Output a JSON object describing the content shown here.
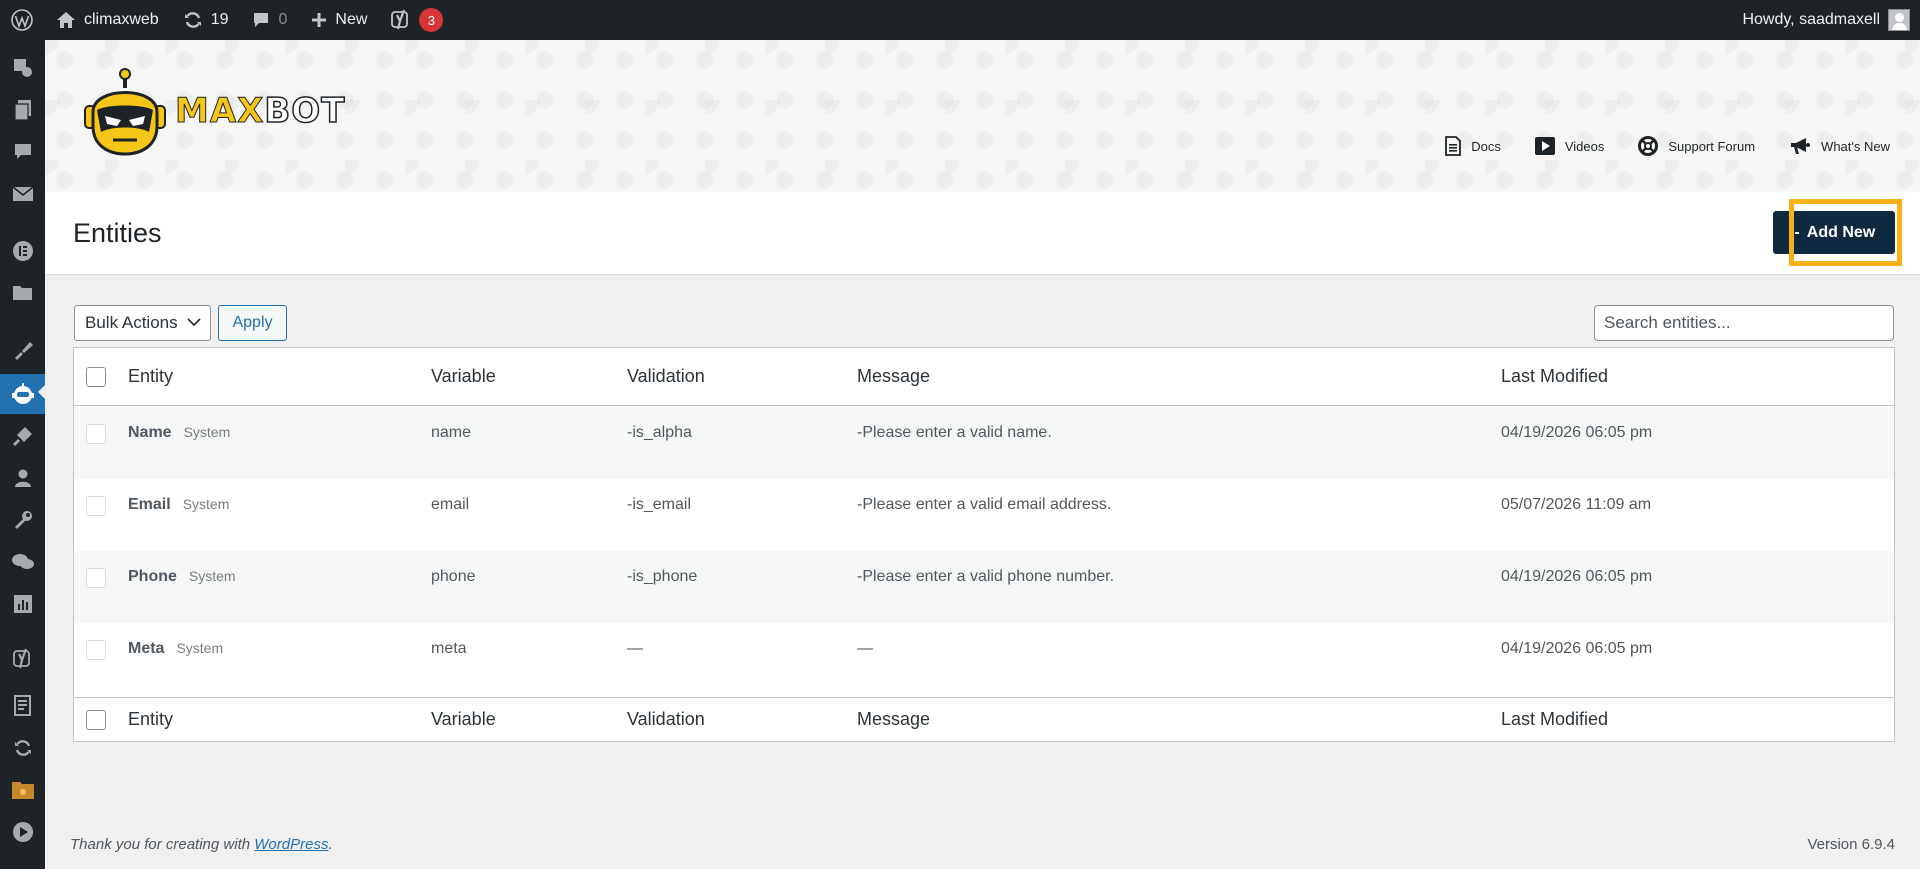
{
  "adminbar": {
    "site_name": "climaxweb",
    "updates_count": "19",
    "comments_count": "0",
    "new_label": "New",
    "seo_badge": "3",
    "greeting": "Howdy, saadmaxell"
  },
  "plugin": {
    "logo_max": "MAX",
    "logo_bot": "BOT",
    "links": {
      "docs": "Docs",
      "videos": "Videos",
      "support": "Support Forum",
      "whats_new": "What's New"
    }
  },
  "page": {
    "title": "Entities",
    "add_new_label": "Add New"
  },
  "controls": {
    "bulk_actions": "Bulk Actions",
    "apply": "Apply",
    "search_placeholder": "Search entities..."
  },
  "table": {
    "columns": {
      "entity": "Entity",
      "variable": "Variable",
      "validation": "Validation",
      "message": "Message",
      "last_modified": "Last Modified"
    },
    "rows": [
      {
        "name": "Name",
        "type": "System",
        "variable": "name",
        "validation": "-is_alpha",
        "message": "-Please enter a valid name.",
        "modified": "04/19/2026 06:05 pm"
      },
      {
        "name": "Email",
        "type": "System",
        "variable": "email",
        "validation": "-is_email",
        "message": "-Please enter a valid email address.",
        "modified": "05/07/2026 11:09 am"
      },
      {
        "name": "Phone",
        "type": "System",
        "variable": "phone",
        "validation": "-is_phone",
        "message": "-Please enter a valid phone number.",
        "modified": "04/19/2026 06:05 pm"
      },
      {
        "name": "Meta",
        "type": "System",
        "variable": "meta",
        "validation": "—",
        "message": "—",
        "modified": "04/19/2026 06:05 pm"
      }
    ]
  },
  "footer": {
    "thanks_prefix": "Thank you for creating with ",
    "wordpress_link": "WordPress",
    "thanks_suffix": ".",
    "version": "Version 6.9.4"
  },
  "colors": {
    "admin_dark": "#1d2327",
    "accent_blue": "#2271b1",
    "button_navy": "#0f2a40",
    "highlight_orange": "#f7b217",
    "badge_red": "#d63638"
  }
}
